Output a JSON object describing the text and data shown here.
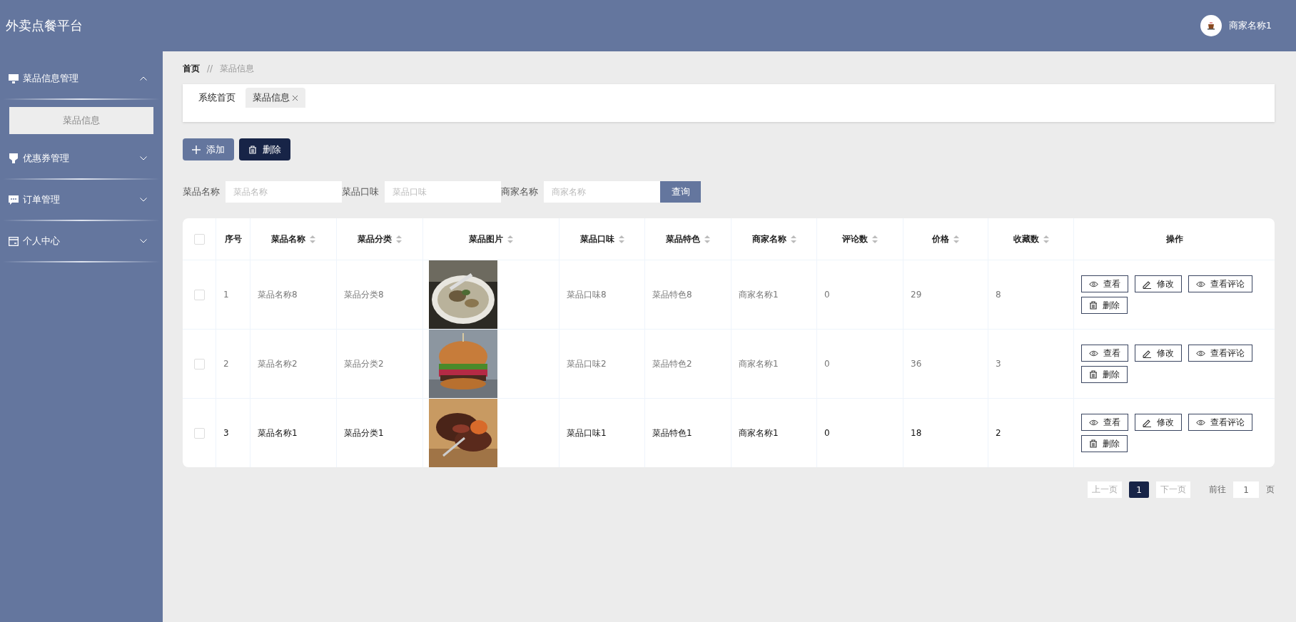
{
  "header": {
    "title": "外卖点餐平台",
    "user": "商家名称1"
  },
  "sidebar": {
    "items": [
      {
        "label": "菜品信息管理",
        "expanded": true,
        "children": [
          {
            "label": "菜品信息",
            "selected": true
          }
        ]
      },
      {
        "label": "优惠券管理",
        "expanded": false
      },
      {
        "label": "订单管理",
        "expanded": false
      },
      {
        "label": "个人中心",
        "expanded": false
      }
    ]
  },
  "breadcrumb": [
    "首页",
    "//",
    "菜品信息"
  ],
  "tabs": [
    {
      "label": "系统首页",
      "selected": false,
      "closable": false
    },
    {
      "label": "菜品信息",
      "selected": true,
      "closable": true
    }
  ],
  "actions": [
    {
      "label": "添加",
      "kind": "add"
    },
    {
      "label": "删除",
      "kind": "delete"
    }
  ],
  "search": {
    "fields": [
      {
        "label": "菜品名称",
        "placeholder": "菜品名称"
      },
      {
        "label": "菜品口味",
        "placeholder": "菜品口味"
      },
      {
        "label": "商家名称",
        "placeholder": "商家名称"
      }
    ],
    "button": "查询"
  },
  "table": {
    "select_all_checked": false,
    "columns": [
      {
        "label": "序号",
        "sortable": false
      },
      {
        "label": "菜品名称",
        "sortable": true
      },
      {
        "label": "菜品分类",
        "sortable": true
      },
      {
        "label": "菜品图片",
        "sortable": true
      },
      {
        "label": "菜品口味",
        "sortable": true
      },
      {
        "label": "菜品特色",
        "sortable": true
      },
      {
        "label": "商家名称",
        "sortable": true
      },
      {
        "label": "评论数",
        "sortable": true
      },
      {
        "label": "价格",
        "sortable": true
      },
      {
        "label": "收藏数",
        "sortable": true
      },
      {
        "label": "操作",
        "sortable": false
      }
    ],
    "rows": [
      {
        "checked": false,
        "hovered": false,
        "cells": [
          "1",
          "菜品名称8",
          "菜品分类8",
          {
            "kind": "picture"
          },
          "菜品口味8",
          "菜品特色8",
          "商家名称1",
          "0",
          "29",
          "8"
        ],
        "actions": [
          {
            "label": "查看",
            "kind": "view"
          },
          {
            "label": "修改",
            "kind": "edit"
          },
          {
            "label": "查看评论",
            "kind": "view"
          },
          {
            "label": "删除",
            "kind": "delete"
          }
        ]
      },
      {
        "checked": false,
        "hovered": false,
        "cells": [
          "2",
          "菜品名称2",
          "菜品分类2",
          {
            "kind": "picture"
          },
          "菜品口味2",
          "菜品特色2",
          "商家名称1",
          "0",
          "36",
          "3"
        ],
        "actions": [
          {
            "label": "查看",
            "kind": "view"
          },
          {
            "label": "修改",
            "kind": "edit"
          },
          {
            "label": "查看评论",
            "kind": "view"
          },
          {
            "label": "删除",
            "kind": "delete"
          }
        ]
      },
      {
        "checked": false,
        "hovered": true,
        "cells": [
          "3",
          "菜品名称1",
          "菜品分类1",
          {
            "kind": "picture"
          },
          "菜品口味1",
          "菜品特色1",
          "商家名称1",
          "0",
          "18",
          "2"
        ],
        "actions": [
          {
            "label": "查看",
            "kind": "view"
          },
          {
            "label": "修改",
            "kind": "edit"
          },
          {
            "label": "查看评论",
            "kind": "view"
          },
          {
            "label": "删除",
            "kind": "delete"
          }
        ]
      }
    ]
  },
  "pagination": {
    "prev": "上一页",
    "pages": [
      {
        "label": "1",
        "selected": true
      }
    ],
    "next": "下一页",
    "goto_label": "前往",
    "goto_value": "1",
    "goto_suffix": "页"
  }
}
